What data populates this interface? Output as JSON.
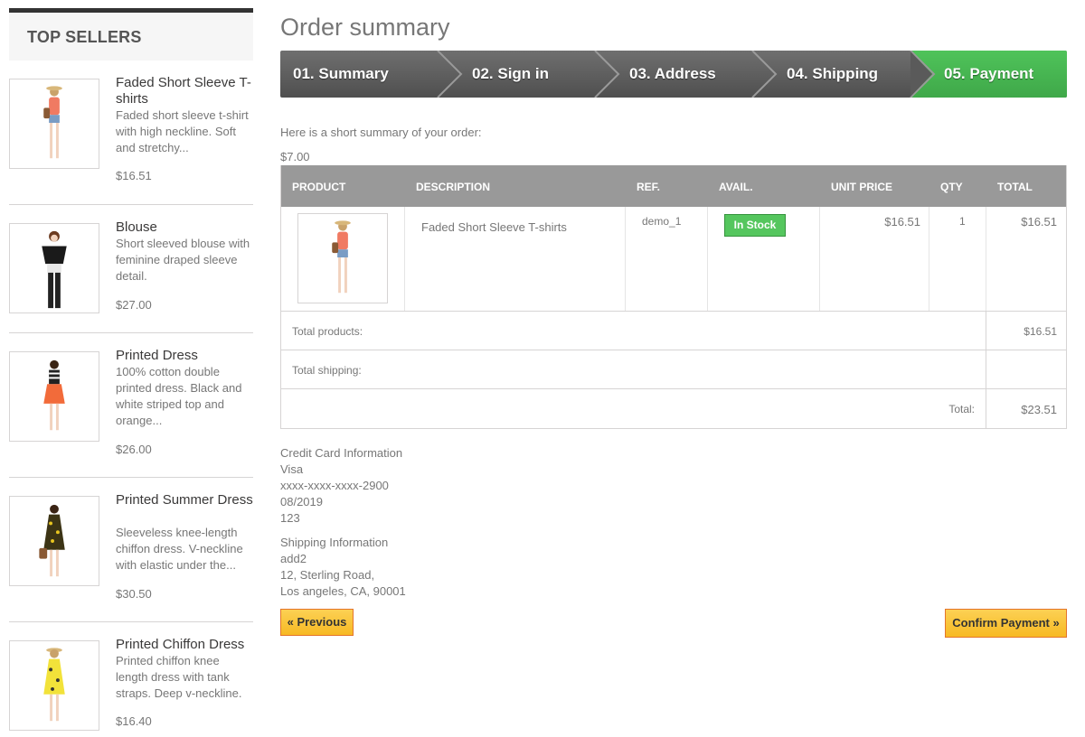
{
  "sidebar": {
    "title": "Top sellers",
    "items": [
      {
        "name": "Faded Short Sleeve T-shirts",
        "desc": "Faded short sleeve t-shirt with high neckline. Soft and stretchy...",
        "price": "$16.51"
      },
      {
        "name": "Blouse",
        "desc": "Short sleeved blouse with feminine draped sleeve detail.",
        "price": "$27.00"
      },
      {
        "name": "Printed Dress",
        "desc": "100% cotton double printed dress. Black and white striped top and orange...",
        "price": "$26.00"
      },
      {
        "name": "Printed Summer Dress",
        "desc": "Sleeveless knee-length chiffon dress. V-neckline with elastic under the...",
        "price": "$30.50"
      },
      {
        "name": "Printed Chiffon Dress",
        "desc": "Printed chiffon knee length dress with tank straps. Deep v-neckline.",
        "price": "$16.40"
      }
    ]
  },
  "main": {
    "title": "Order summary",
    "steps": [
      "01. Summary",
      "02. Sign in",
      "03. Address",
      "04. Shipping",
      "05. Payment"
    ],
    "intro": "Here is a short summary of your order:",
    "amount": "$7.00",
    "table": {
      "headers": [
        "Product",
        "Description",
        "Ref.",
        "Avail.",
        "Unit price",
        "Qty",
        "Total"
      ],
      "row": {
        "description": "Faded Short Sleeve T-shirts",
        "ref": "demo_1",
        "avail": "In Stock",
        "unit_price": "$16.51",
        "qty": "1",
        "total": "$16.51"
      },
      "total_products_label": "Total products:",
      "total_products_value": "$16.51",
      "total_shipping_label": "Total shipping:",
      "total_shipping_value": "",
      "total_label": "Total:",
      "total_value": "$23.51"
    },
    "credit_card": {
      "title": "Credit Card Information",
      "type": "Visa",
      "number": "xxxx-xxxx-xxxx-2900",
      "expiry": "08/2019",
      "cvv": "123"
    },
    "shipping": {
      "title": "Shipping Information",
      "name": "add2",
      "street": "12, Sterling Road,",
      "city": "Los angeles, CA, 90001"
    },
    "buttons": {
      "previous": "« Previous",
      "confirm": "Confirm Payment »"
    }
  },
  "colors": {
    "step_inactive": "#5e5e5e",
    "step_active": "#46a74e",
    "in_stock": "#55c65e",
    "button": "#fdc52b"
  }
}
